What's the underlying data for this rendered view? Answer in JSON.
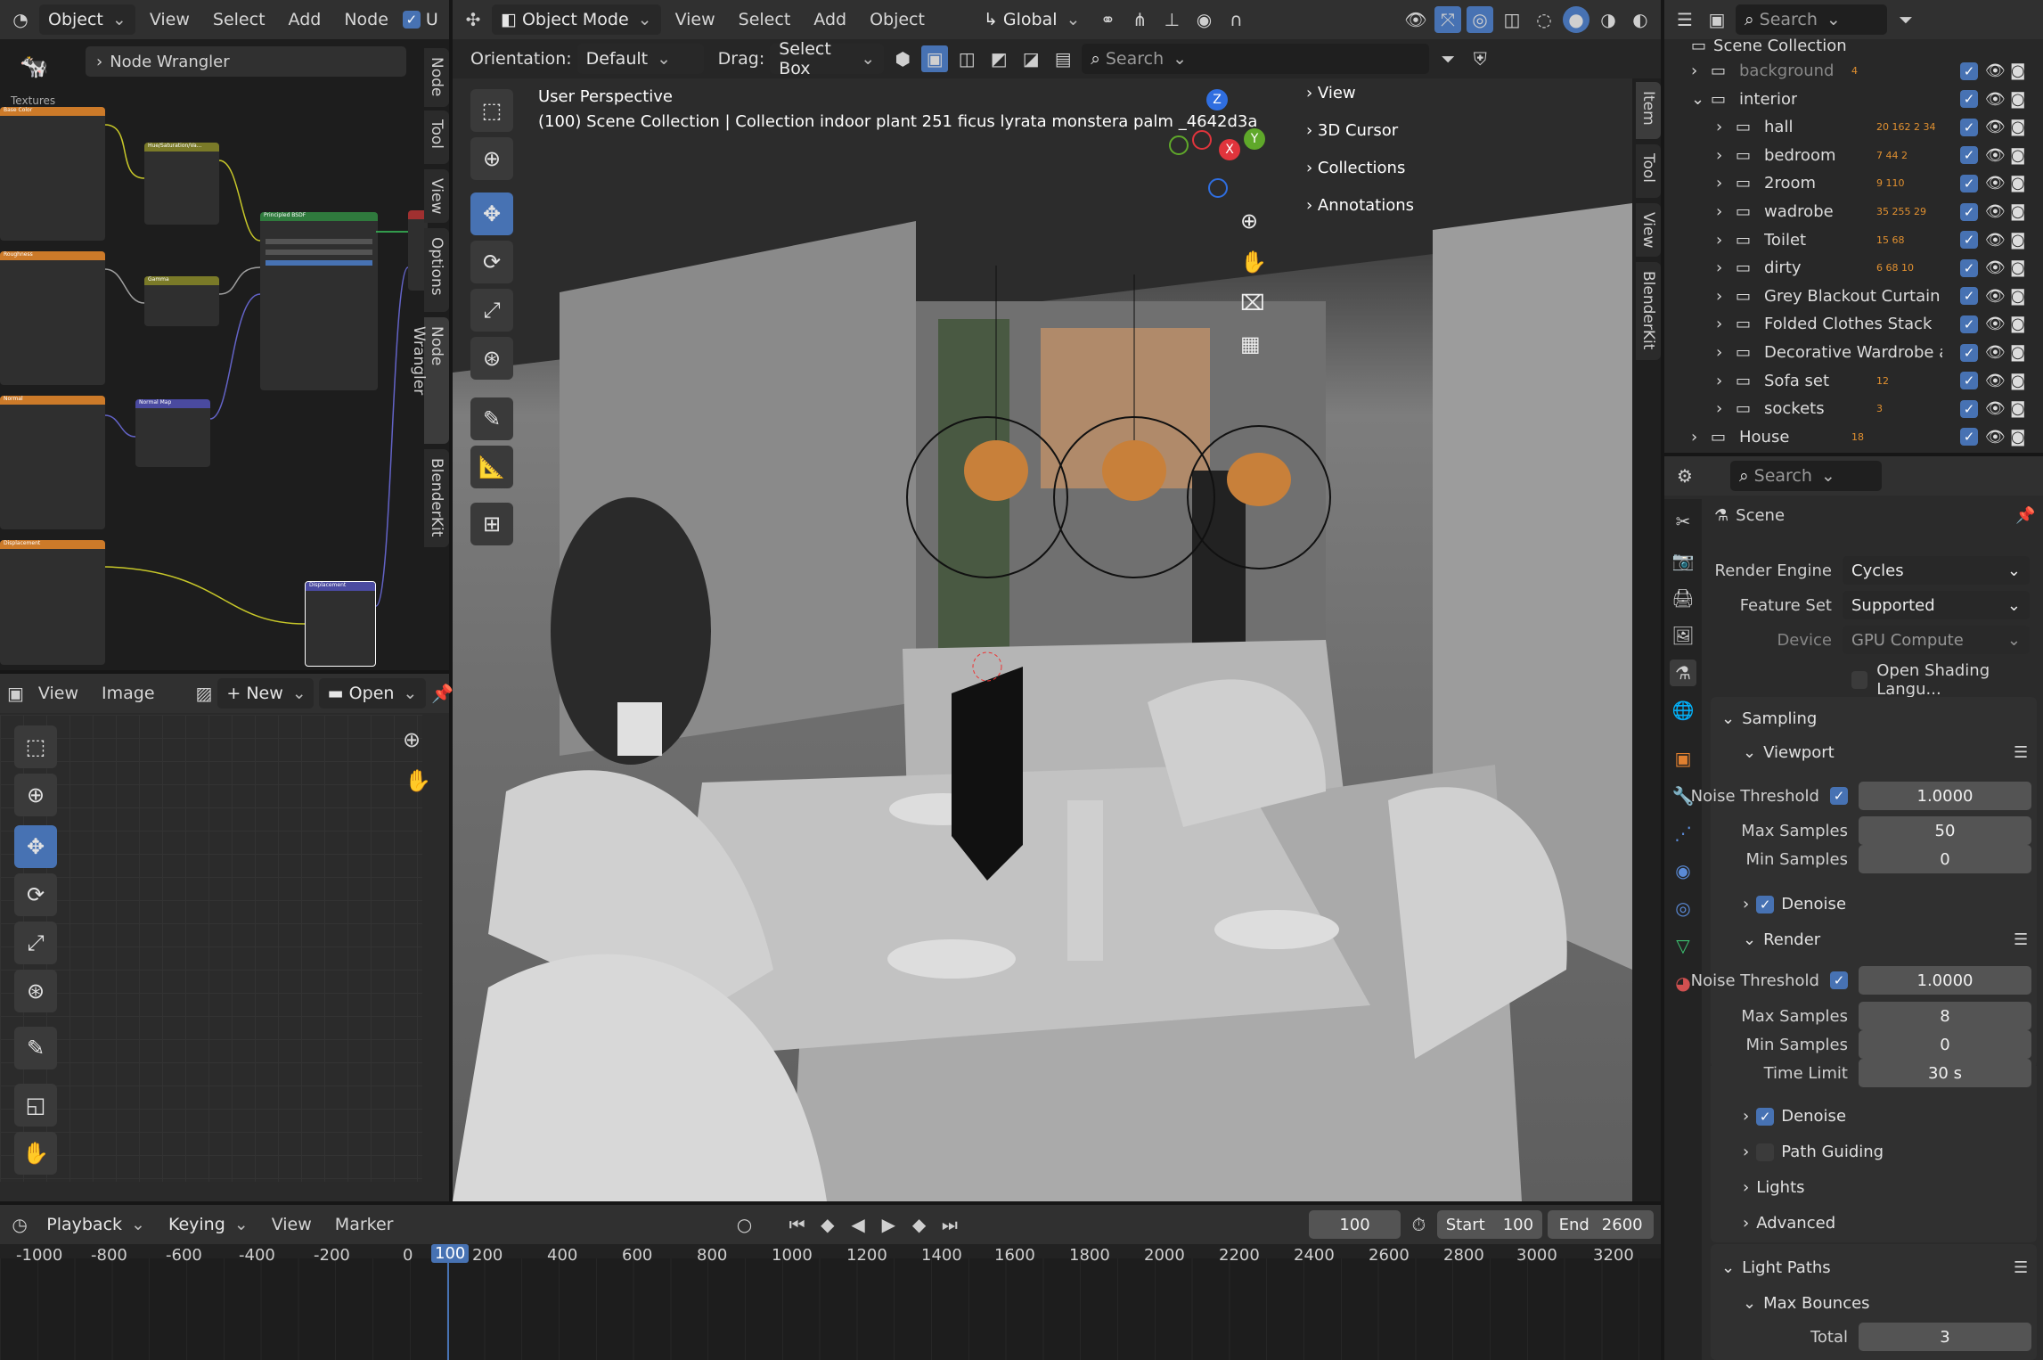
{
  "node_editor": {
    "header": {
      "editor_mode": "Object",
      "menus": [
        "View",
        "Select",
        "Add",
        "Node"
      ],
      "use_label": "U"
    },
    "breadcrumb": "Node Wrangler",
    "frame_label": "Textures",
    "side_tabs": [
      "Node",
      "Tool",
      "View",
      "Options",
      "Node Wrangler",
      "BlenderKit"
    ],
    "nodes": {
      "hsv": "Hue/Saturation/Va...",
      "gamma": "Gamma",
      "normal_map": "Normal Map",
      "bsdf": "Principled BSDF",
      "displacement": "Displacement",
      "base_color": "Base Color",
      "roughness": "Roughness",
      "normal": "Normal",
      "disp_tex": "Displacement"
    }
  },
  "image_editor": {
    "menus": [
      "View",
      "Image"
    ],
    "new_label": "New",
    "open_label": "Open"
  },
  "viewport": {
    "header": {
      "mode": "Object Mode",
      "menus": [
        "View",
        "Select",
        "Add",
        "Object"
      ],
      "transform": "Global"
    },
    "tool_header": {
      "orientation_label": "Orientation:",
      "orientation_value": "Default",
      "drag_label": "Drag:",
      "drag_value": "Select Box",
      "search_placeholder": "Search"
    },
    "overlay_title": "User Perspective",
    "overlay_subtitle": "(100) Scene Collection | Collection indoor plant 251 ficus lyrata monstera palm _4642d3a",
    "panels": [
      "View",
      "3D Cursor",
      "Collections",
      "Annotations"
    ],
    "side_tabs": [
      "Item",
      "Tool",
      "View",
      "BlenderKit"
    ],
    "gizmo": {
      "z": "Z",
      "x": "X",
      "y": "Y"
    }
  },
  "outliner": {
    "search_placeholder": "Search",
    "root": "Scene Collection",
    "items": [
      {
        "name": "background",
        "indent": 0,
        "counts": "4"
      },
      {
        "name": "interior",
        "indent": 0,
        "counts": ""
      },
      {
        "name": "hall",
        "indent": 1,
        "counts": "20 162 2 34"
      },
      {
        "name": "bedroom",
        "indent": 1,
        "counts": "7 44 2"
      },
      {
        "name": "2room",
        "indent": 1,
        "counts": "9 110"
      },
      {
        "name": "wadrobe",
        "indent": 1,
        "counts": "35 255 29"
      },
      {
        "name": "Toilet",
        "indent": 1,
        "counts": "15 68"
      },
      {
        "name": "dirty",
        "indent": 1,
        "counts": "6 68 10"
      },
      {
        "name": "Grey Blackout Curtain wit",
        "indent": 1,
        "counts": ""
      },
      {
        "name": "Folded Clothes Stack",
        "indent": 1,
        "counts": ""
      },
      {
        "name": "Decorative Wardrobe and",
        "indent": 1,
        "counts": ""
      },
      {
        "name": "Sofa set",
        "indent": 1,
        "counts": "12"
      },
      {
        "name": "sockets",
        "indent": 1,
        "counts": "3"
      },
      {
        "name": "House",
        "indent": 0,
        "counts": "18"
      }
    ]
  },
  "properties": {
    "search_placeholder": "Search",
    "context": "Scene",
    "render_engine_label": "Render Engine",
    "render_engine": "Cycles",
    "feature_set_label": "Feature Set",
    "feature_set": "Supported",
    "device_label": "Device",
    "device": "GPU Compute",
    "open_shading": "Open Shading Langu...",
    "sampling": "Sampling",
    "viewport": "Viewport",
    "render": "Render",
    "noise_threshold_label": "Noise Threshold",
    "vp_noise": "1.0000",
    "max_samples_label": "Max Samples",
    "vp_max": "50",
    "min_samples_label": "Min Samples",
    "vp_min": "0",
    "denoise": "Denoise",
    "r_noise": "1.0000",
    "r_max": "8",
    "r_min": "0",
    "time_limit_label": "Time Limit",
    "time_limit": "30 s",
    "path_guiding": "Path Guiding",
    "lights": "Lights",
    "advanced": "Advanced",
    "light_paths": "Light Paths",
    "max_bounces": "Max Bounces",
    "total_label": "Total",
    "total": "3"
  },
  "timeline": {
    "menus": [
      "Playback",
      "Keying",
      "View",
      "Marker"
    ],
    "current": "100",
    "start_label": "Start",
    "start": "100",
    "end_label": "End",
    "end": "2600",
    "ticks": [
      "-1000",
      "-800",
      "-600",
      "-400",
      "-200",
      "0",
      "100",
      "200",
      "400",
      "600",
      "800",
      "1000",
      "1200",
      "1400",
      "1600",
      "1800",
      "2000",
      "2200",
      "2400",
      "2600",
      "2800",
      "3000",
      "3200"
    ]
  },
  "colors": {
    "accent": "#4772b3",
    "header": "#303030",
    "viewport_bg": "#7a7a7a",
    "panel": "#303030"
  }
}
